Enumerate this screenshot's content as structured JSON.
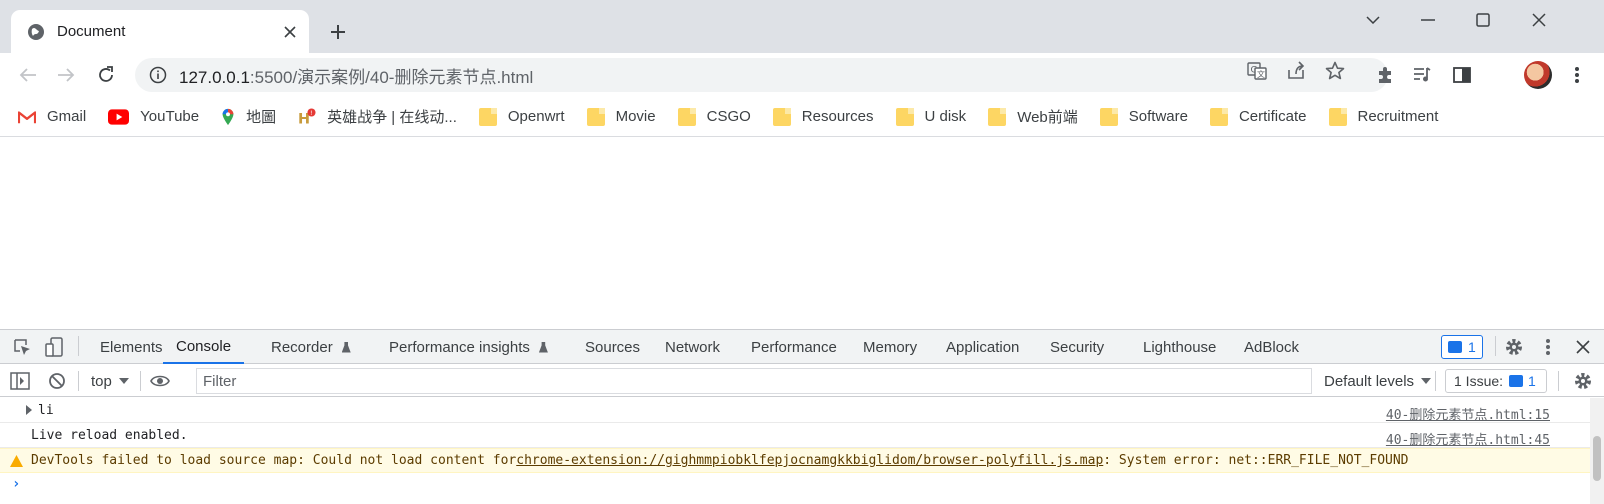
{
  "tab": {
    "title": "Document"
  },
  "omnibox": {
    "host": "127.0.0.1",
    "path": ":5500/演示案例/40-删除元素节点.html"
  },
  "bookmarks": [
    {
      "icon": "gmail-icon",
      "label": "Gmail"
    },
    {
      "icon": "youtube-icon",
      "label": "YouTube"
    },
    {
      "icon": "maps-icon",
      "label": "地圖"
    },
    {
      "icon": "lol-icon",
      "label": "英雄战争 | 在线动..."
    },
    {
      "icon": "folder-icon",
      "label": "Openwrt"
    },
    {
      "icon": "folder-icon",
      "label": "Movie"
    },
    {
      "icon": "folder-icon",
      "label": "CSGO"
    },
    {
      "icon": "folder-icon",
      "label": "Resources"
    },
    {
      "icon": "folder-icon",
      "label": "U disk"
    },
    {
      "icon": "folder-icon",
      "label": "Web前端"
    },
    {
      "icon": "folder-icon",
      "label": "Software"
    },
    {
      "icon": "folder-icon",
      "label": "Certificate"
    },
    {
      "icon": "folder-icon",
      "label": "Recruitment"
    }
  ],
  "devtools": {
    "tabs": [
      "Elements",
      "Console",
      "Recorder",
      "Performance insights",
      "Sources",
      "Network",
      "Performance",
      "Memory",
      "Application",
      "Security",
      "Lighthouse",
      "AdBlock"
    ],
    "active_tab": "Console",
    "issues_badge": "1",
    "context": "top",
    "filter_placeholder": "Filter",
    "levels": "Default levels",
    "issue_label": "1 Issue:",
    "issue_count": "1",
    "messages": [
      {
        "text": "li",
        "source": "40-删除元素节点.html:15"
      },
      {
        "text": "Live reload enabled.",
        "source": "40-删除元素节点.html:45"
      }
    ],
    "warning": {
      "prefix": "DevTools failed to load source map: Could not load content for ",
      "link": "chrome-extension://gighmmpiobklfepjocnamgkkbiglidom/browser-polyfill.js.map",
      "suffix": ": System error: net::ERR_FILE_NOT_FOUND"
    }
  },
  "colors": {
    "accent": "#1a73e8",
    "tabstrip": "#dee1e6",
    "warning_bg": "#fffbe5"
  }
}
